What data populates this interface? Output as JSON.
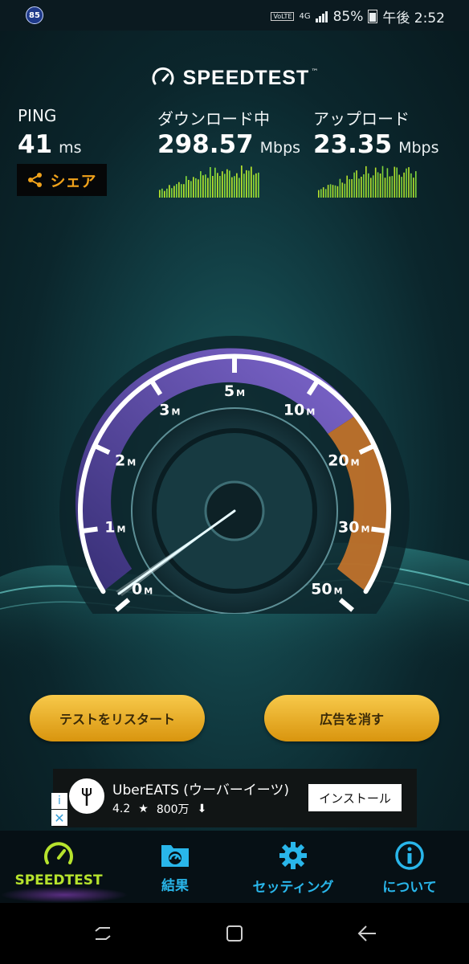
{
  "status_bar": {
    "badge": "85",
    "volte": "VoLTE",
    "network": "4G",
    "battery": "85%",
    "time": "午後 2:52"
  },
  "header": {
    "logo_text": "SPEEDTEST",
    "logo_tm": "™"
  },
  "stats": {
    "ping": {
      "label": "PING",
      "value": "41",
      "unit": "ms"
    },
    "download": {
      "label": "ダウンロード中",
      "value": "298.57",
      "unit": "Mbps"
    },
    "upload": {
      "label": "アップロード",
      "value": "23.35",
      "unit": "Mbps"
    }
  },
  "share_label": "シェア",
  "gauge": {
    "ticks": [
      "0",
      "1",
      "2",
      "3",
      "5",
      "10",
      "20",
      "30",
      "50"
    ],
    "tick_unit": "M"
  },
  "buttons": {
    "restart": "テストをリスタート",
    "remove_ads": "広告を消す"
  },
  "ad": {
    "title": "UberEATS (ウーバーイーツ)",
    "rating": "4.2",
    "downloads": "800万",
    "install_label": "インストール",
    "info_glyph": "i",
    "close_glyph": "✕"
  },
  "nav": {
    "items": [
      {
        "label": "SPEEDTEST",
        "icon": "speedometer-icon",
        "color": "#b6e32d"
      },
      {
        "label": "結果",
        "icon": "results-icon",
        "color": "#29b6ea"
      },
      {
        "label": "セッティング",
        "icon": "gear-icon",
        "color": "#29b6ea"
      },
      {
        "label": "について",
        "icon": "info-icon",
        "color": "#29b6ea"
      }
    ]
  },
  "colors": {
    "accent_gold": "#f0a21b",
    "gauge_purple": "#7a5ed0",
    "gauge_orange": "#d77a2c",
    "nav_blue": "#29b6ea",
    "nav_green": "#b6e32d"
  }
}
